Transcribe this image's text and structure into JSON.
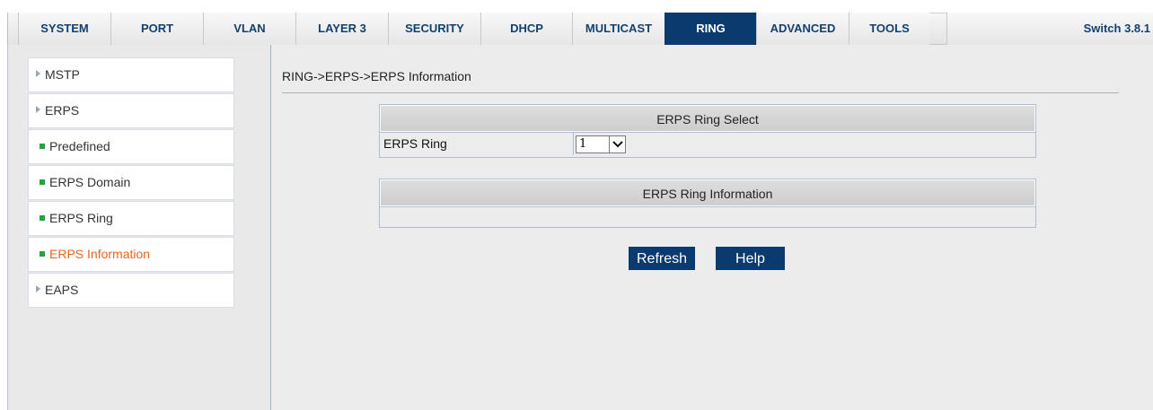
{
  "nav": {
    "tabs": [
      {
        "label": "SYSTEM"
      },
      {
        "label": "PORT"
      },
      {
        "label": "VLAN"
      },
      {
        "label": "LAYER 3"
      },
      {
        "label": "SECURITY"
      },
      {
        "label": "DHCP"
      },
      {
        "label": "MULTICAST"
      },
      {
        "label": "RING",
        "active": true
      },
      {
        "label": "ADVANCED"
      },
      {
        "label": "TOOLS"
      }
    ],
    "version": "Switch 3.8.1"
  },
  "sidebar": {
    "items": [
      {
        "label": "MSTP",
        "type": "section"
      },
      {
        "label": "ERPS",
        "type": "section"
      },
      {
        "label": "Predefined",
        "type": "sub"
      },
      {
        "label": "ERPS Domain",
        "type": "sub"
      },
      {
        "label": "ERPS Ring",
        "type": "sub"
      },
      {
        "label": "ERPS Information",
        "type": "sub",
        "active": true
      },
      {
        "label": "EAPS",
        "type": "section"
      }
    ]
  },
  "main": {
    "breadcrumb": "RING->ERPS->ERPS Information",
    "select_panel": {
      "title": "ERPS Ring Select",
      "row_label": "ERPS Ring",
      "ring_value": "1"
    },
    "info_panel": {
      "title": "ERPS Ring Information"
    },
    "buttons": {
      "refresh": "Refresh",
      "help": "Help"
    }
  },
  "colors": {
    "nav_active": "#0b3a6e",
    "nav_text": "#14406e",
    "sidebar_active_text": "#e8661c",
    "sub_marker": "#27a33a",
    "button_bg": "#0b3a6e"
  }
}
